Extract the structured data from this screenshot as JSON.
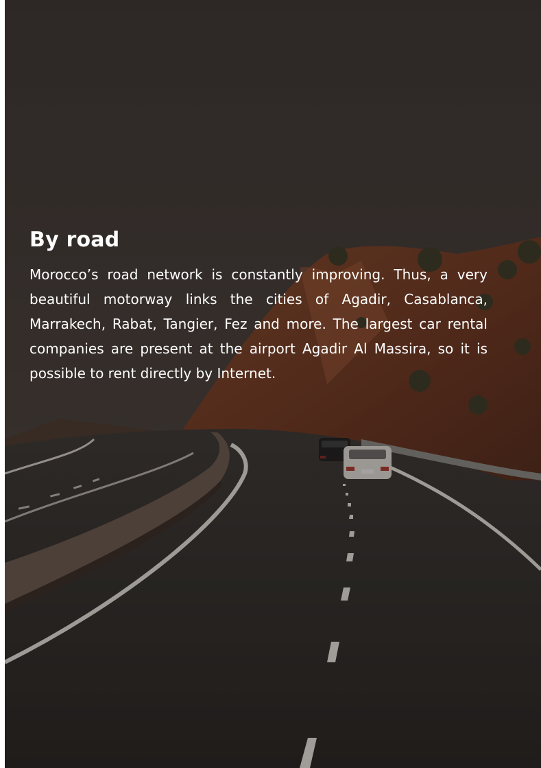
{
  "section": {
    "title": "By road",
    "body": "Morocco’s road network is constantly improving. Thus, a very beautiful motorway links the cities of Agadir, Casablanca, Marrakech, Rabat, Tangier, Fez and more. The largest car rental companies are present at the airport Agadir Al Massira, so it is possible to rent directly by Internet."
  },
  "background": {
    "image_subject": "motorway-through-hills",
    "colors": {
      "sky": "#3d3736",
      "hill": "#7a3f26",
      "road": "#2e2b2a",
      "lane_marking": "#e9e4df"
    }
  }
}
